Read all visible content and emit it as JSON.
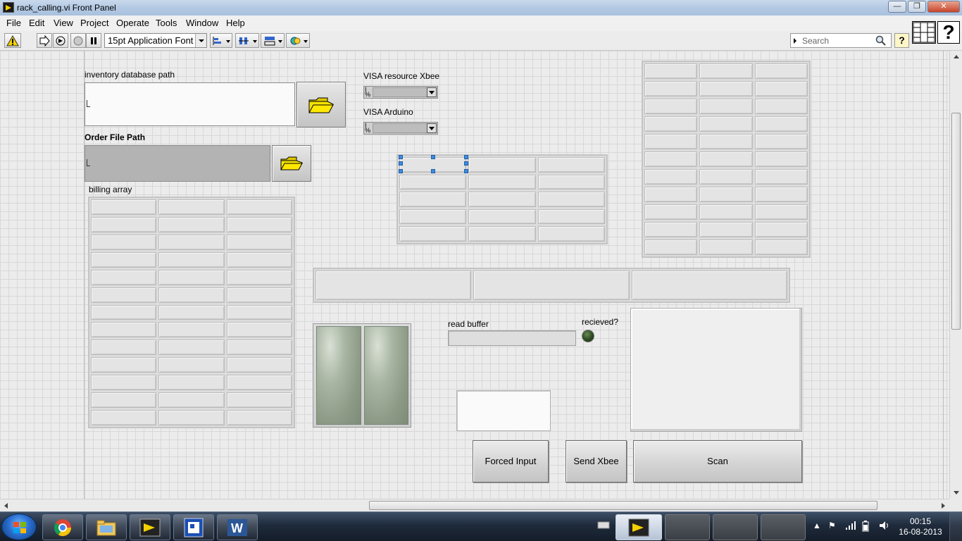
{
  "window": {
    "title": "rack_calling.vi Front Panel",
    "minimize": "—",
    "maximize": "❐",
    "close": "✕"
  },
  "menu": [
    "File",
    "Edit",
    "View",
    "Project",
    "Operate",
    "Tools",
    "Window",
    "Help"
  ],
  "toolbar": {
    "font": "15pt Application Font",
    "search_placeholder": "Search",
    "help": "?"
  },
  "panel": {
    "inventory_label": "inventory database path",
    "order_label": "Order File Path",
    "billing_label": "billing array",
    "visa_xbee_label": "VISA resource Xbee",
    "visa_arduino_label": "VISA Arduino",
    "read_buffer_label": "read buffer",
    "received_label": "recieved?",
    "buttons": {
      "forced_input": "Forced Input",
      "send_xbee": "Send Xbee",
      "scan": "Scan"
    },
    "received_led": "off"
  },
  "colors": {
    "canvas": "#ececec",
    "led_off": "#2c4a22",
    "selection": "#3c8dde"
  },
  "taskbar": {
    "apps": [
      "windows-start",
      "chrome",
      "file-explorer",
      "labview",
      "vi-window",
      "word",
      "labview-active"
    ],
    "time": "00:15",
    "date": "16-08-2013"
  }
}
